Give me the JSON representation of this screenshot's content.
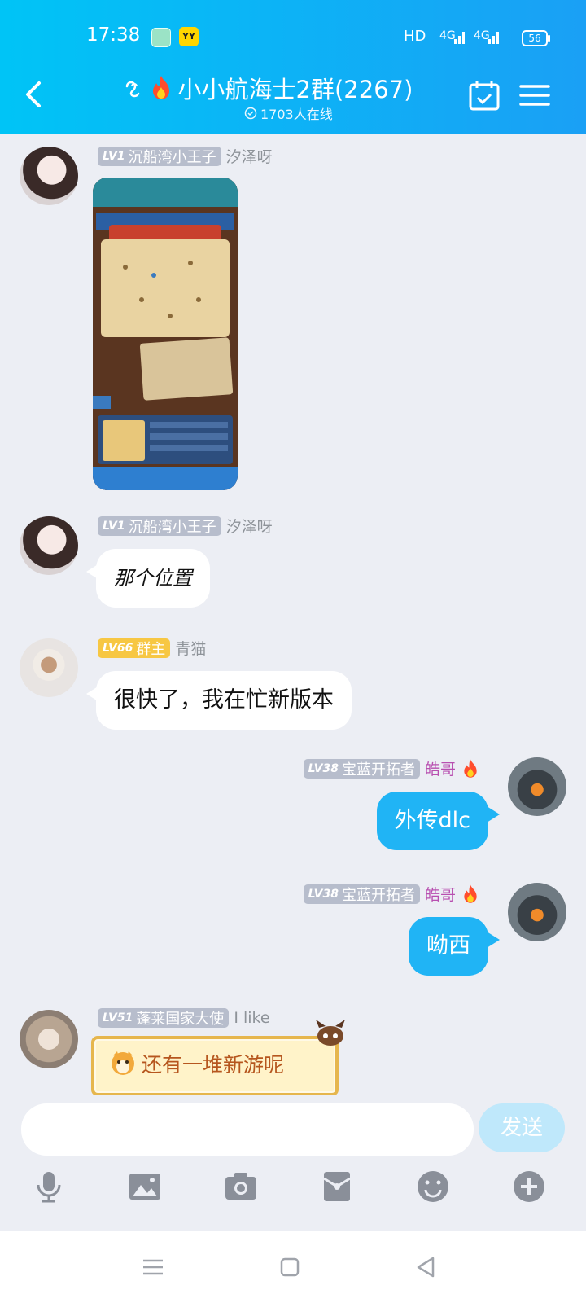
{
  "status_bar": {
    "time": "17:38",
    "network": "HD",
    "sim1": "4G",
    "sim2": "4G",
    "battery": "56",
    "app_icons": [
      "green-app-icon",
      "yy-app-icon"
    ],
    "yy_label": "YY"
  },
  "header": {
    "title": "小小航海士2群(2267)",
    "subtitle": "1703人在线",
    "back_icon": "chevron-left-icon",
    "calendar_icon": "calendar-check-icon",
    "menu_icon": "hamburger-menu-icon",
    "ear_icon": "ear-icon",
    "flame_icon": "flame-icon"
  },
  "messages": [
    {
      "id": "msg1",
      "side": "left",
      "level": "LV1",
      "title": "沉船湾小王子",
      "name": "汐泽呀",
      "kind": "image",
      "image_label": "game-screenshot-world-map"
    },
    {
      "id": "msg2",
      "side": "left",
      "level": "LV1",
      "title": "沉船湾小王子",
      "name": "汐泽呀",
      "kind": "text",
      "text": "那个位置"
    },
    {
      "id": "msg3",
      "side": "left",
      "level": "LV66",
      "title": "群主",
      "name": "青猫",
      "kind": "text",
      "text": "很快了，我在忙新版本"
    },
    {
      "id": "msg4",
      "side": "right",
      "level": "LV38",
      "title": "宝蓝开拓者",
      "name": "皓哥",
      "kind": "text",
      "text": "外传dlc"
    },
    {
      "id": "msg5",
      "side": "right",
      "level": "LV38",
      "title": "宝蓝开拓者",
      "name": "皓哥",
      "kind": "text",
      "text": "呦西"
    },
    {
      "id": "msg6",
      "side": "left",
      "level": "LV51",
      "title": "蓬莱国家大使",
      "name": "I like",
      "kind": "fancy-text",
      "text": "还有一堆新游呢"
    }
  ],
  "input": {
    "placeholder": "",
    "send_label": "发送"
  },
  "toolbar": [
    "microphone-icon",
    "image-icon",
    "camera-icon",
    "red-packet-icon",
    "emoji-icon",
    "plus-icon"
  ],
  "nav": [
    "recents-icon",
    "home-icon",
    "back-icon"
  ],
  "colors": {
    "header_start": "#00c4f6",
    "header_end": "#1aa0f5",
    "bubble_blue": "#20b4f5",
    "background": "#eceef4",
    "owner_badge": "#f7c743",
    "level_badge": "#b7bdcc"
  }
}
